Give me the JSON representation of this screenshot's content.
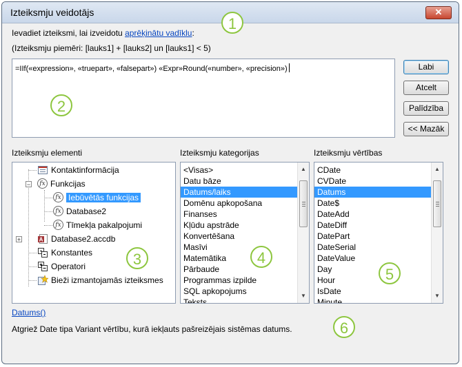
{
  "window": {
    "title": "Izteiksmju veidotājs",
    "close_glyph": "✕"
  },
  "instructions": {
    "prefix": "Ievadiet izteiksmi, lai izveidotu ",
    "link": "aprēķinātu vadīklu",
    "suffix": ":",
    "examples": "(Izteiksmju piemēri: [lauks1] + [lauks2] un [lauks1] < 5)"
  },
  "expression": {
    "value": "=IIf(«expression», «truepart», «falsepart») «Expr»Round(«number», «precision»)"
  },
  "buttons": {
    "ok": "Labi",
    "cancel": "Atcelt",
    "help": "Palīdzība",
    "less": "<< Mazāk"
  },
  "panels": {
    "elements": {
      "label": "Izteiksmju elementi",
      "items": [
        {
          "label": "Kontaktinformācija",
          "icon": "form-icon"
        },
        {
          "label": "Funkcijas",
          "icon": "fx-icon"
        },
        {
          "label": "Iebūvētās funkcijas",
          "icon": "fx-icon",
          "selected": true
        },
        {
          "label": "Database2",
          "icon": "fx-icon"
        },
        {
          "label": "Tīmekļa pakalpojumi",
          "icon": "fx-icon"
        },
        {
          "label": "Database2.accdb",
          "icon": "access-db-icon"
        },
        {
          "label": "Konstantes",
          "icon": "constants-icon"
        },
        {
          "label": "Operatori",
          "icon": "operators-icon"
        },
        {
          "label": "Bieži izmantojamās izteiksmes",
          "icon": "common-expressions-icon"
        }
      ]
    },
    "categories": {
      "label": "Izteiksmju kategorijas",
      "items": [
        "<Visas>",
        "Datu bāze",
        "Datums/laiks",
        "Domēnu apkopošana",
        "Finanses",
        "Kļūdu apstrāde",
        "Konvertēšana",
        "Masīvi",
        "Matemātika",
        "Pārbaude",
        "Programmas izpilde",
        "SQL apkopojums",
        "Teksts"
      ],
      "selected_index": 2
    },
    "values": {
      "label": "Izteiksmju vērtības",
      "items": [
        "CDate",
        "CVDate",
        "Datums",
        "Date$",
        "DateAdd",
        "DateDiff",
        "DatePart",
        "DateSerial",
        "DateValue",
        "Day",
        "Hour",
        "IsDate",
        "Minute"
      ],
      "selected_index": 2
    }
  },
  "footer": {
    "function_link": "Datums()",
    "description": "Atgriež Date tipa Variant vērtību, kurā iekļauts pašreizējais sistēmas datums."
  },
  "callouts": [
    "1",
    "2",
    "3",
    "4",
    "5",
    "6"
  ],
  "colors": {
    "selection": "#3399ff",
    "callout": "#8dc63f",
    "link": "#0645c0"
  }
}
